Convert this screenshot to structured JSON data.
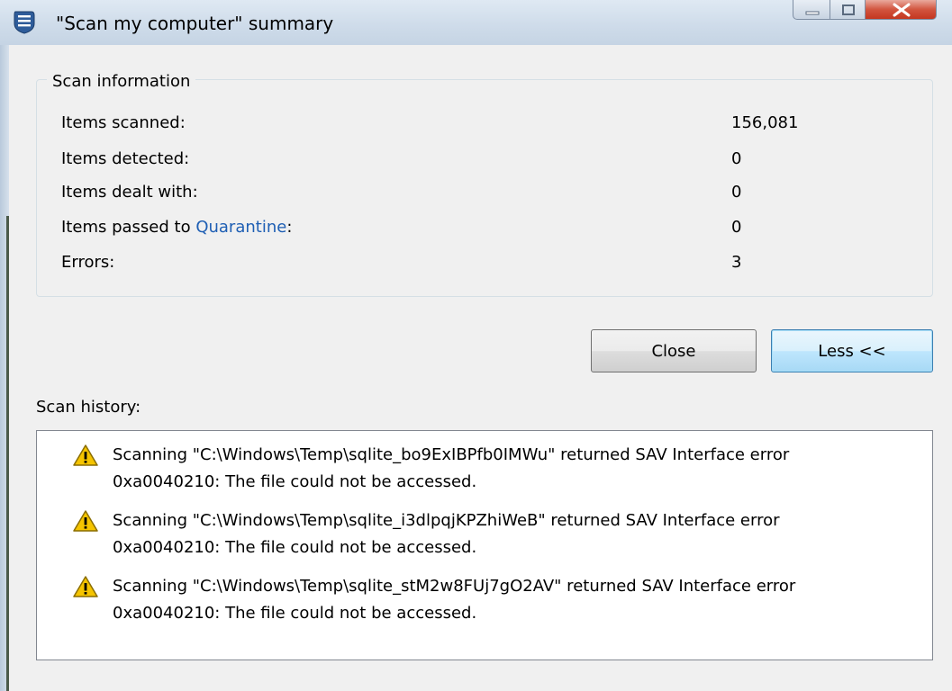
{
  "window": {
    "title": "\"Scan my computer\" summary"
  },
  "scan_info": {
    "legend": "Scan information",
    "rows": [
      {
        "label": "Items scanned:",
        "value": "156,081"
      },
      {
        "label": "Items detected:",
        "value": "0"
      },
      {
        "label": "Items dealt with:",
        "value": "0"
      },
      {
        "label_prefix": "Items passed to ",
        "link": "Quarantine",
        "label_suffix": ":",
        "value": "0"
      },
      {
        "label": "Errors:",
        "value": "3"
      }
    ]
  },
  "buttons": {
    "close_label": "Close",
    "less_label": "Less <<"
  },
  "history": {
    "label": "Scan history:",
    "entries": [
      {
        "icon": "warning-icon",
        "line1": "Scanning \"C:\\Windows\\Temp\\sqlite_bo9ExIBPfb0IMWu\" returned SAV Interface error",
        "line2": "0xa0040210: The file could not be accessed."
      },
      {
        "icon": "warning-icon",
        "line1": "Scanning \"C:\\Windows\\Temp\\sqlite_i3dlpqjKPZhiWeB\" returned SAV Interface error",
        "line2": "0xa0040210: The file could not be accessed."
      },
      {
        "icon": "warning-icon",
        "line1": "Scanning \"C:\\Windows\\Temp\\sqlite_stM2w8FUj7gO2AV\" returned SAV Interface error",
        "line2": "0xa0040210: The file could not be accessed."
      }
    ]
  },
  "colors": {
    "link": "#1f5fb4",
    "warning_fill": "#f5c400",
    "close_button": "#c4361f"
  }
}
